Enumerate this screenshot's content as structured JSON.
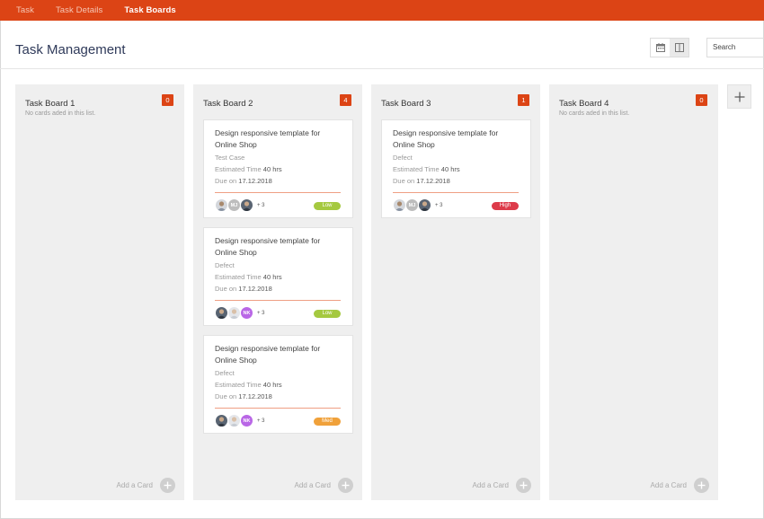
{
  "nav": {
    "items": [
      {
        "label": "Task",
        "active": false
      },
      {
        "label": "Task Details",
        "active": false
      },
      {
        "label": "Task Boards",
        "active": true
      }
    ]
  },
  "header": {
    "title": "Task Management",
    "search_placeholder": "Search",
    "view_icons": [
      "calendar-icon",
      "columns-icon"
    ]
  },
  "boards": [
    {
      "title": "Task Board 1",
      "count": "0",
      "empty_text": "No cards aded in this list.",
      "add_label": "Add a Card",
      "cards": []
    },
    {
      "title": "Task Board 2",
      "count": "4",
      "empty_text": "",
      "add_label": "Add a Card",
      "cards": [
        {
          "title": "Design responsive template for Online Shop",
          "type": "Test Case",
          "est_label": "Estimated Time",
          "est_value": "40 hrs",
          "due_label": "Due on",
          "due_value": "17.12.2018",
          "avatar_initials": [
            "",
            "MJ",
            ""
          ],
          "more": "+ 3",
          "priority": "Low"
        },
        {
          "title": "Design responsive template for Online Shop",
          "type": "Defect",
          "est_label": "Estimated Time",
          "est_value": "40 hrs",
          "due_label": "Due on",
          "due_value": "17.12.2018",
          "avatar_initials": [
            "",
            "",
            "NK"
          ],
          "more": "+ 3",
          "priority": "Low"
        },
        {
          "title": "Design responsive template for Online Shop",
          "type": "Defect",
          "est_label": "Estimated Time",
          "est_value": "40 hrs",
          "due_label": "Due on",
          "due_value": "17.12.2018",
          "avatar_initials": [
            "",
            "",
            "NK"
          ],
          "more": "+ 3",
          "priority": "Med"
        }
      ]
    },
    {
      "title": "Task Board 3",
      "count": "1",
      "empty_text": "",
      "add_label": "Add a Card",
      "cards": [
        {
          "title": "Design responsive template for Online Shop",
          "type": "Defect",
          "est_label": "Estimated Time",
          "est_value": "40 hrs",
          "due_label": "Due on",
          "due_value": "17.12.2018",
          "avatar_initials": [
            "",
            "MJ",
            ""
          ],
          "more": "+ 3",
          "priority": "High"
        }
      ]
    },
    {
      "title": "Task Board 4",
      "count": "0",
      "empty_text": "No cards aded in this list.",
      "add_label": "Add a Card",
      "cards": []
    }
  ],
  "colors": {
    "brand": "#dc4415",
    "low": "#a5c940",
    "med": "#f0a13a",
    "high": "#dd3b4a",
    "avatar_mj": "#bdbdbd",
    "avatar_nk": "#b967e6",
    "avatar_photo_a": "#7d8a99",
    "avatar_photo_b": "#596472",
    "avatar_photo_c": "#d4d7dc"
  },
  "add_board_icon": "plus-icon"
}
